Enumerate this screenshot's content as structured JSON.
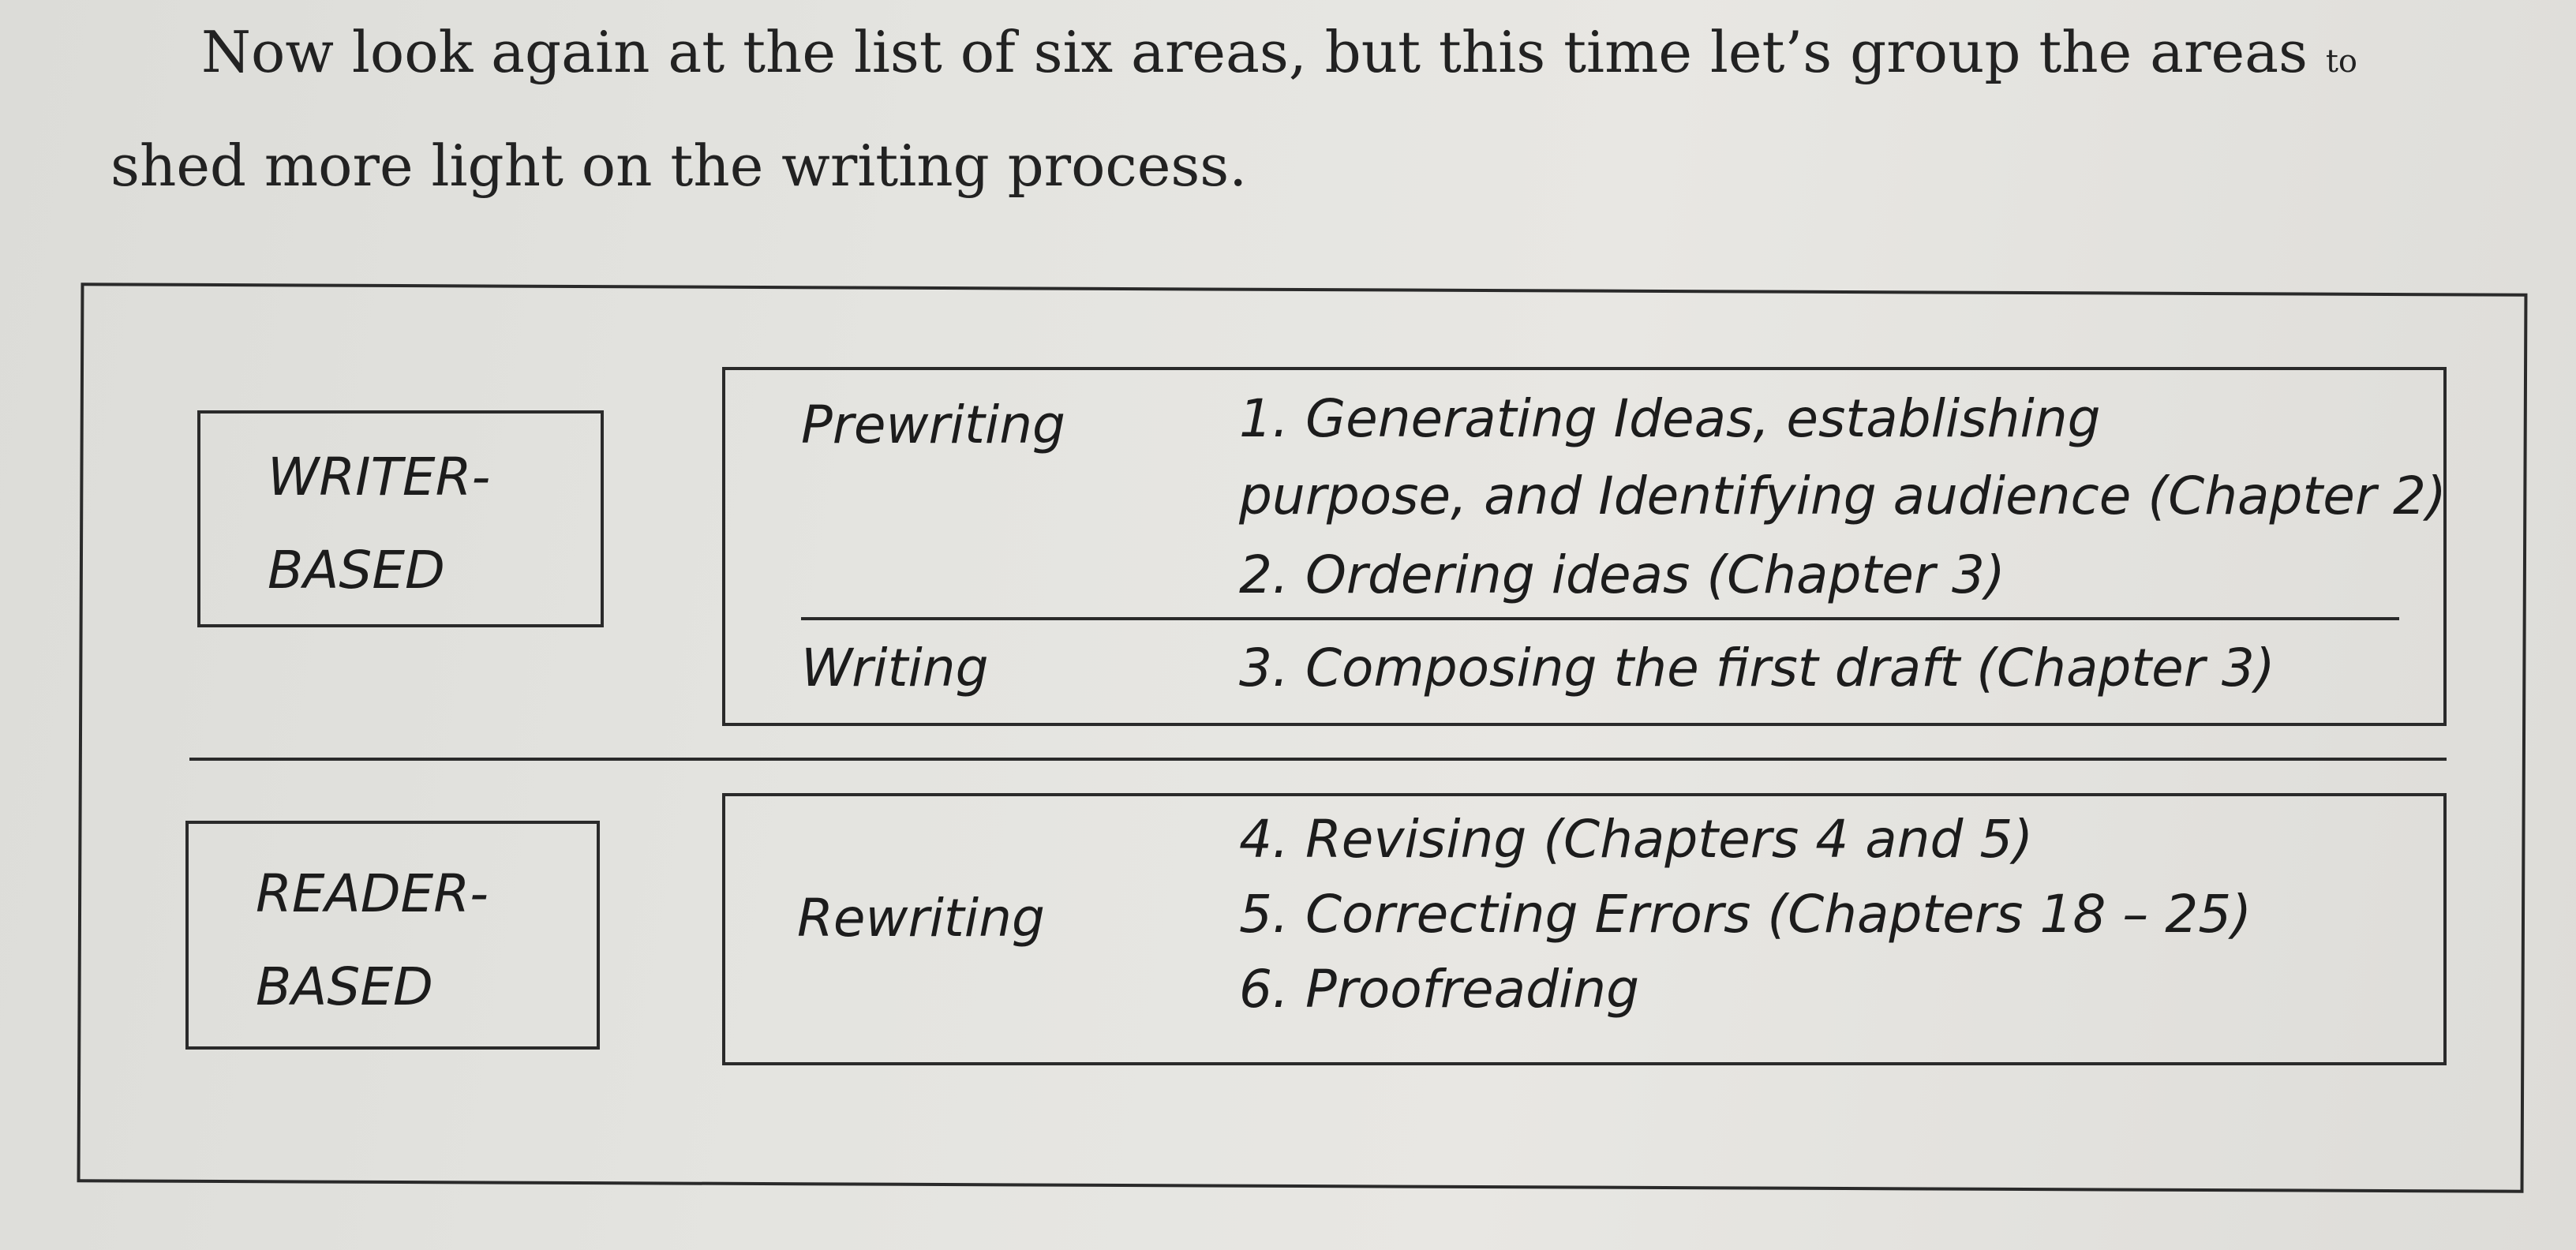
{
  "intro": {
    "line1_main": "Now look again at the list of six areas, but this time let’s group the areas",
    "line1_tail": "to",
    "line2": "shed more light on the writing process."
  },
  "writer_based": {
    "line1": "WRITER-",
    "line2": "BASED",
    "prewriting_label": "Prewriting",
    "writing_label": "Writing",
    "items": [
      "1. Generating Ideas, establishing",
      "purpose, and Identifying audience (Chapter 2)",
      "2. Ordering ideas (Chapter 3)",
      "3. Composing the first draft (Chapter 3)"
    ]
  },
  "reader_based": {
    "line1": "READER-",
    "line2": "BASED",
    "rewriting_label": "Rewriting",
    "items": [
      "4. Revising (Chapters 4 and 5)",
      "5. Correcting Errors (Chapters 18 – 25)",
      "6. Proofreading"
    ]
  }
}
